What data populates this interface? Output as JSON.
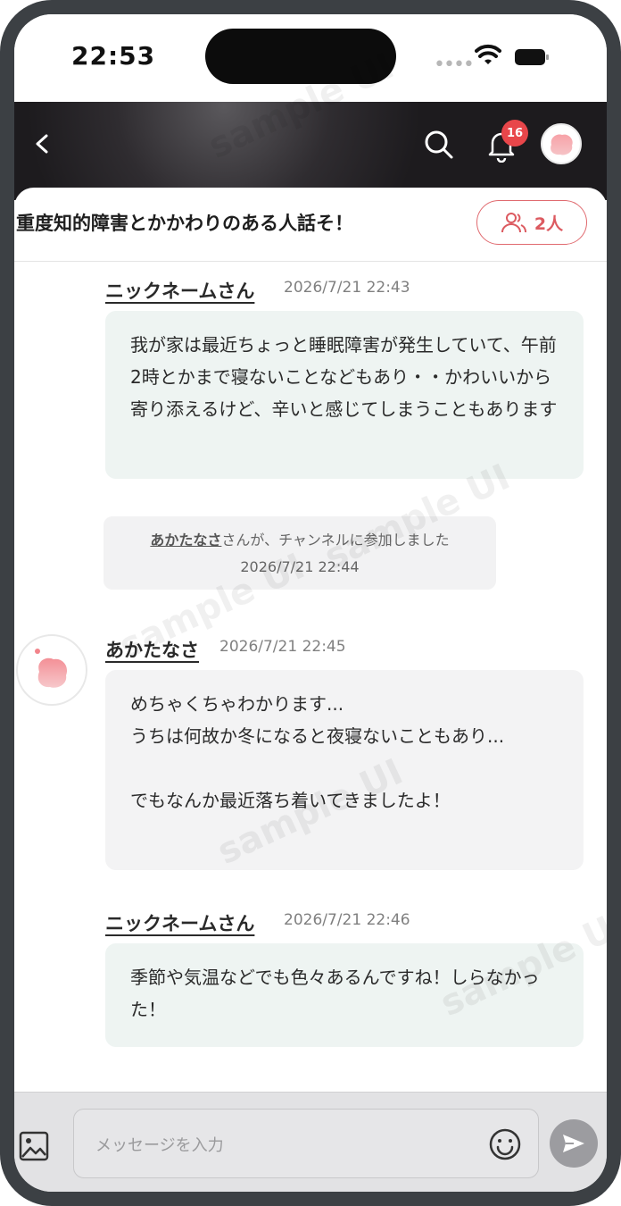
{
  "status_bar": {
    "time": "22:53"
  },
  "header": {
    "notification_count": "16"
  },
  "channel": {
    "title": "重度知的障害とかかわりのある人話そ！",
    "member_count": "2人"
  },
  "messages": [
    {
      "author": "ニックネームさん",
      "timestamp": "2026/7/21 22:43",
      "text": "我が家は最近ちょっと睡眠障害が発生していて、午前2時とかまで寝ないことなどもあり・・かわいいから寄り添えるけど、辛いと感じてしまうこともあります"
    },
    {
      "system_user": "あかたなさ",
      "system_text": "さんが、チャンネルに参加しました",
      "timestamp": "2026/7/21 22:44"
    },
    {
      "author": "あかたなさ",
      "timestamp": "2026/7/21 22:45",
      "text": "めちゃくちゃわかります...\nうちは何故か冬になると夜寝ないこともあり...\n\nでもなんか最近落ち着いてきましたよ！"
    },
    {
      "author": "ニックネームさん",
      "timestamp": "2026/7/21 22:46",
      "text": "季節や気温などでも色々あるんですね！しらなかった！"
    }
  ],
  "composer": {
    "placeholder": "メッセージを入力"
  },
  "watermark": "sample UI",
  "colors": {
    "accent": "#e06a6f",
    "badge": "#e8464a",
    "self_bubble": "#eef4f2",
    "other_bubble": "#f3f3f4"
  }
}
